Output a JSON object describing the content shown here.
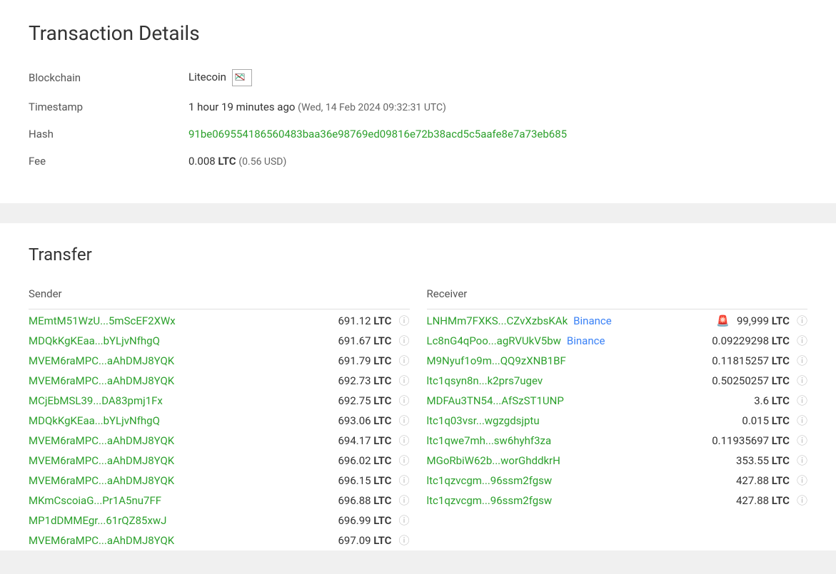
{
  "details": {
    "title": "Transaction Details",
    "rows": {
      "blockchain": {
        "label": "Blockchain",
        "value": "Litecoin"
      },
      "timestamp": {
        "label": "Timestamp",
        "relative": "1 hour 19 minutes ago",
        "absolute": "(Wed, 14 Feb 2024 09:32:31 UTC)"
      },
      "hash": {
        "label": "Hash",
        "value": "91be069554186560483baa36e98769ed09816e72b38acd5c5aafe8e7a73eb685"
      },
      "fee": {
        "label": "Fee",
        "amount": "0.008",
        "currency": "LTC",
        "usd": "(0.56 USD)"
      }
    }
  },
  "transfer": {
    "title": "Transfer",
    "sender_label": "Sender",
    "receiver_label": "Receiver",
    "currency": "LTC",
    "senders": [
      {
        "addr": "MEmtM51WzU...5mScEF2XWx",
        "amount": "691.12"
      },
      {
        "addr": "MDQkKgKEaa...bYLjvNfhgQ",
        "amount": "691.67"
      },
      {
        "addr": "MVEM6raMPC...aAhDMJ8YQK",
        "amount": "691.79"
      },
      {
        "addr": "MVEM6raMPC...aAhDMJ8YQK",
        "amount": "692.73"
      },
      {
        "addr": "MCjEbMSL39...DA83pmj1Fx",
        "amount": "692.75"
      },
      {
        "addr": "MDQkKgKEaa...bYLjvNfhgQ",
        "amount": "693.06"
      },
      {
        "addr": "MVEM6raMPC...aAhDMJ8YQK",
        "amount": "694.17"
      },
      {
        "addr": "MVEM6raMPC...aAhDMJ8YQK",
        "amount": "696.02"
      },
      {
        "addr": "MVEM6raMPC...aAhDMJ8YQK",
        "amount": "696.15"
      },
      {
        "addr": "MKmCscoiaG...Pr1A5nu7FF",
        "amount": "696.88"
      },
      {
        "addr": "MP1dDMMEgr...61rQZ85xwJ",
        "amount": "696.99"
      },
      {
        "addr": "MVEM6raMPC...aAhDMJ8YQK",
        "amount": "697.09"
      }
    ],
    "receivers": [
      {
        "addr": "LNHMm7FXKS...CZvXzbsKAk",
        "tag": "Binance",
        "amount": "99,999",
        "alert": true
      },
      {
        "addr": "Lc8nG4qPoo...agRVUkV5bw",
        "tag": "Binance",
        "amount": "0.09229298"
      },
      {
        "addr": "M9Nyuf1o9m...QQ9zXNB1BF",
        "amount": "0.11815257"
      },
      {
        "addr": "ltc1qsyn8n...k2prs7ugev",
        "amount": "0.50250257"
      },
      {
        "addr": "MDFAu3TN54...AfSzST1UNP",
        "amount": "3.6"
      },
      {
        "addr": "ltc1q03vsr...wgzgdsjptu",
        "amount": "0.015"
      },
      {
        "addr": "ltc1qwe7mh...sw6hyhf3za",
        "amount": "0.11935697"
      },
      {
        "addr": "MGoRbiW62b...worGhddkrH",
        "amount": "353.55"
      },
      {
        "addr": "ltc1qzvcgm...96ssm2fgsw",
        "amount": "427.88"
      },
      {
        "addr": "ltc1qzvcgm...96ssm2fgsw",
        "amount": "427.88"
      }
    ]
  }
}
